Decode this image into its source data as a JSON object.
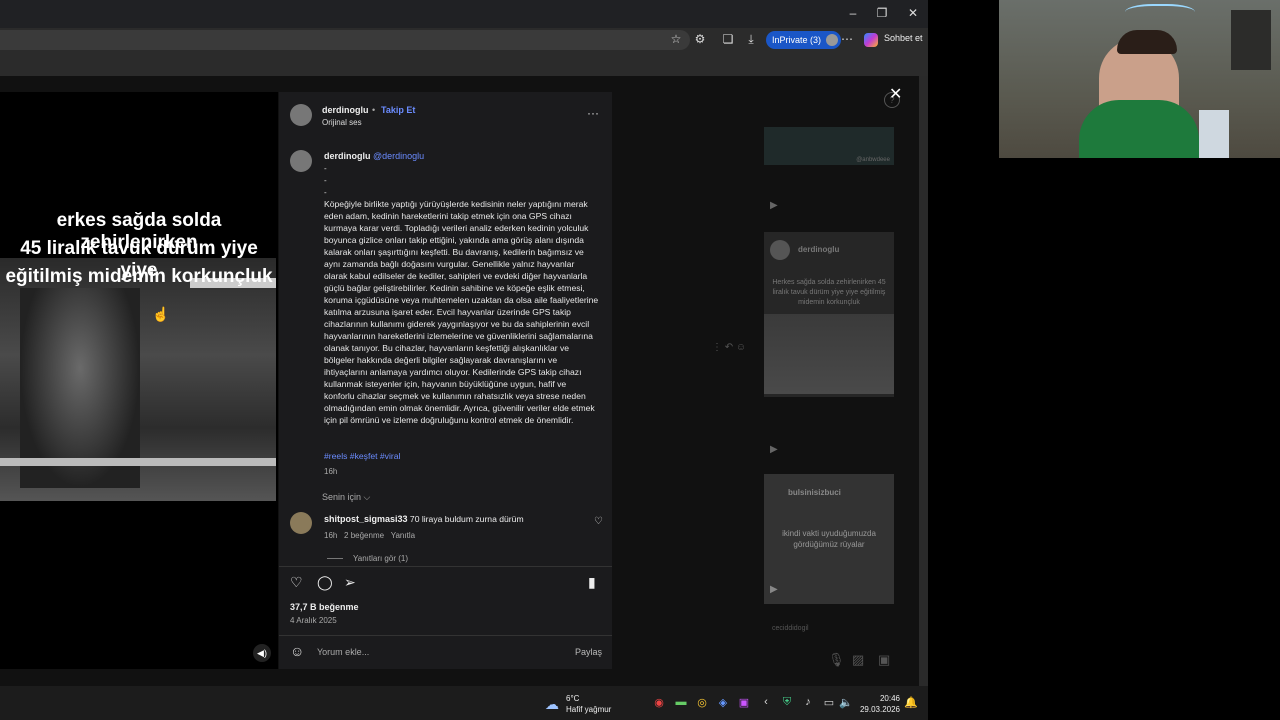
{
  "browser": {
    "inprivate_label": "InPrivate (3)",
    "chat_label": "Sohbet et",
    "minimize": "–",
    "restore": "❐",
    "close": "✕"
  },
  "video": {
    "overlay_lines": [
      "erkes sağda solda zehirlenirken",
      "45 liralık tavuk dürüm yiye yiye",
      "eğitilmiş midemin korkunçluk"
    ]
  },
  "post": {
    "username": "derdinoglu",
    "follow_label": "Takip Et",
    "bullet": "•",
    "audio": "Orijinal ses",
    "more": "···",
    "caption_user": "derdinoglu",
    "caption_handle": "@derdinoglu",
    "caption_dashes": [
      "-",
      "-",
      "-"
    ],
    "caption_body": "Köpeğiyle birlikte yaptığı yürüyüşlerde kedisinin neler yaptığını merak eden adam, kedinin hareketlerini takip etmek için ona GPS cihazı kurmaya karar verdi. Topladığı verileri analiz ederken kedinin yolculuk boyunca gizlice onları takip ettiğini, yakında ama görüş alanı dışında kalarak onları şaşırttığını keşfetti. Bu davranış, kedilerin bağımsız ve aynı zamanda bağlı doğasını vurgular. Genellikle yalnız hayvanlar olarak kabul edilseler de kediler, sahipleri ve evdeki diğer hayvanlarla güçlü bağlar geliştirebilirler. Kedinin sahibine ve köpeğe eşlik etmesi, koruma içgüdüsüne veya muhtemelen uzaktan da olsa aile faaliyetlerine katılma arzusuna işaret eder. Evcil hayvanlar üzerinde GPS takip cihazlarının kullanımı giderek yaygınlaşıyor ve bu da sahiplerinin evcil hayvanlarının hareketlerini izlemelerine ve güvenliklerini sağlamalarına olanak tanıyor. Bu cihazlar, hayvanların keşfettiği alışkanlıklar ve bölgeler hakkında değerli bilgiler sağlayarak davranışlarını ve ihtiyaçlarını anlamaya yardımcı oluyor. Kedilerinde GPS takip cihazı kullanmak isteyenler için, hayvanın büyüklüğüne uygun, hafif ve konforlu cihazlar seçmek ve kullanımın rahatsızlık veya strese neden olmadığından emin olmak önemlidir. Ayrıca, güvenilir veriler elde etmek için pil ömrünü ve izleme doğruluğunu kontrol etmek de önemlidir.",
    "hashtags": "#reels #keşfet #viral",
    "caption_time": "16h",
    "sort_label": "Senin için ⌵",
    "comment": {
      "user": "shitpost_sigmasi33",
      "text": "70 liraya buldum zurna dürüm",
      "time": "16h",
      "likes": "2 beğenme",
      "reply": "Yanıtla",
      "view_replies": "Yanıtları gör (1)"
    },
    "like_count": "37,7 B beğenme",
    "date": "4 Aralık 2025",
    "comment_placeholder": "Yorum ekle...",
    "share_label": "Paylaş"
  },
  "side": {
    "card_user": "derdinoglu",
    "card_caption": "Herkes sağda solda zehirlenirken 45 liralık tavuk dürüm yiye yiye eğitilmiş midemin korkunçluk",
    "card2_user": "bulsinisizbuci",
    "card2_caption": "ikindi vakti uyuduğumuzda gördüğümüz rüyalar",
    "card_top_user": "@anbwdeee",
    "card_bottom_user": "ceciddidogil"
  },
  "taskbar": {
    "temp": "6°C",
    "weather": "Hafif yağmur",
    "time": "20:46",
    "date": "29.03.2026"
  },
  "icons": {
    "close": "close-icon",
    "sound": "sound-icon",
    "heart": "heart-icon",
    "comment": "comment-icon",
    "share": "share-icon",
    "bookmark": "bookmark-icon",
    "emoji": "emoji-icon"
  }
}
